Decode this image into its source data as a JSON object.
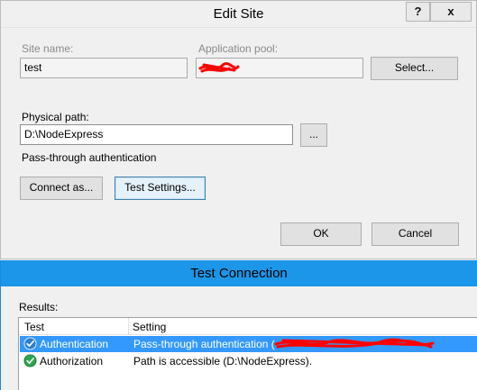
{
  "edit_site": {
    "title": "Edit Site",
    "help_glyph": "?",
    "close_glyph": "x",
    "site_name_label": "Site name:",
    "site_name_value": "test",
    "app_pool_label": "Application pool:",
    "select_label": "Select...",
    "physical_path_label": "Physical path:",
    "physical_path_value": "D:\\NodeExpress",
    "browse_label": "...",
    "auth_text": "Pass-through authentication",
    "connect_as_label": "Connect as...",
    "test_settings_label": "Test Settings...",
    "ok_label": "OK",
    "cancel_label": "Cancel"
  },
  "test_connection": {
    "title": "Test Connection",
    "results_label": "Results:",
    "columns": [
      "Test",
      "Setting"
    ],
    "rows": [
      {
        "test": "Authentication",
        "setting": "Pass-through authentication (",
        "selected": true,
        "status_icon": "check-icon"
      },
      {
        "test": "Authorization",
        "setting": "Path is accessible (D:\\NodeExpress).",
        "selected": false,
        "status_icon": "check-icon"
      }
    ]
  },
  "colors": {
    "active_titlebar": "#1c96e8",
    "selection": "#3399ff",
    "redaction": "#ff0000",
    "check_green": "#2fa44f",
    "check_blue": "#2d7fd1"
  }
}
